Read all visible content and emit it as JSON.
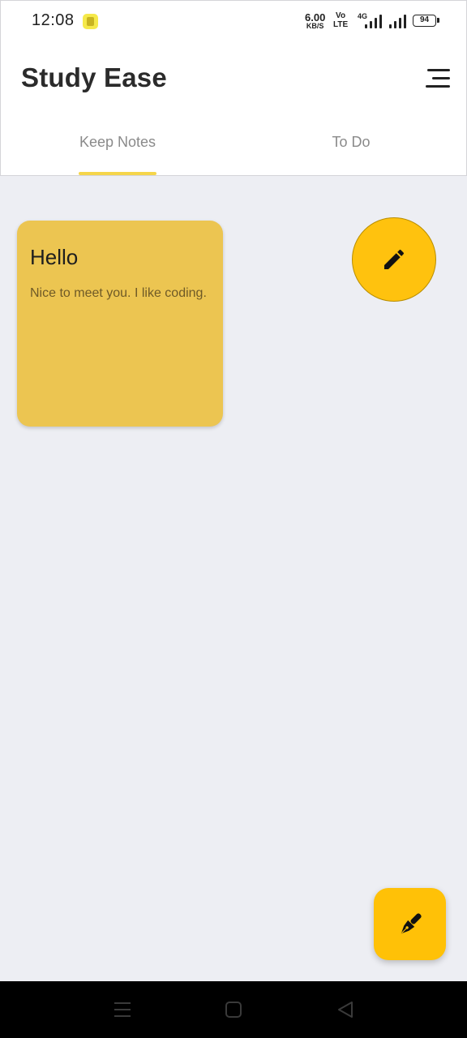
{
  "status_bar": {
    "time": "12:08",
    "speed_value": "6.00",
    "speed_unit": "KB/S",
    "volte_top": "Vo",
    "volte_bottom": "LTE",
    "network": "4G",
    "battery": "94"
  },
  "app_bar": {
    "title": "Study Ease",
    "menu_icon": "menu-icon"
  },
  "tabs": [
    {
      "label": "Keep Notes",
      "active": true
    },
    {
      "label": "To Do",
      "active": false
    }
  ],
  "notes": [
    {
      "title": "Hello",
      "body": "Nice to meet you. I like coding.",
      "color": "#ecc551"
    }
  ],
  "actions": {
    "edit_icon": "pencil-icon",
    "fab_icon": "fountain-pen-icon"
  },
  "navbar": {
    "recent_icon": "menu-lines-icon",
    "home_icon": "home-square-icon",
    "back_icon": "back-triangle-icon"
  },
  "colors": {
    "accent": "#ffc107",
    "note": "#ecc551",
    "background": "#edeef3",
    "indicator": "#f5d54a"
  }
}
